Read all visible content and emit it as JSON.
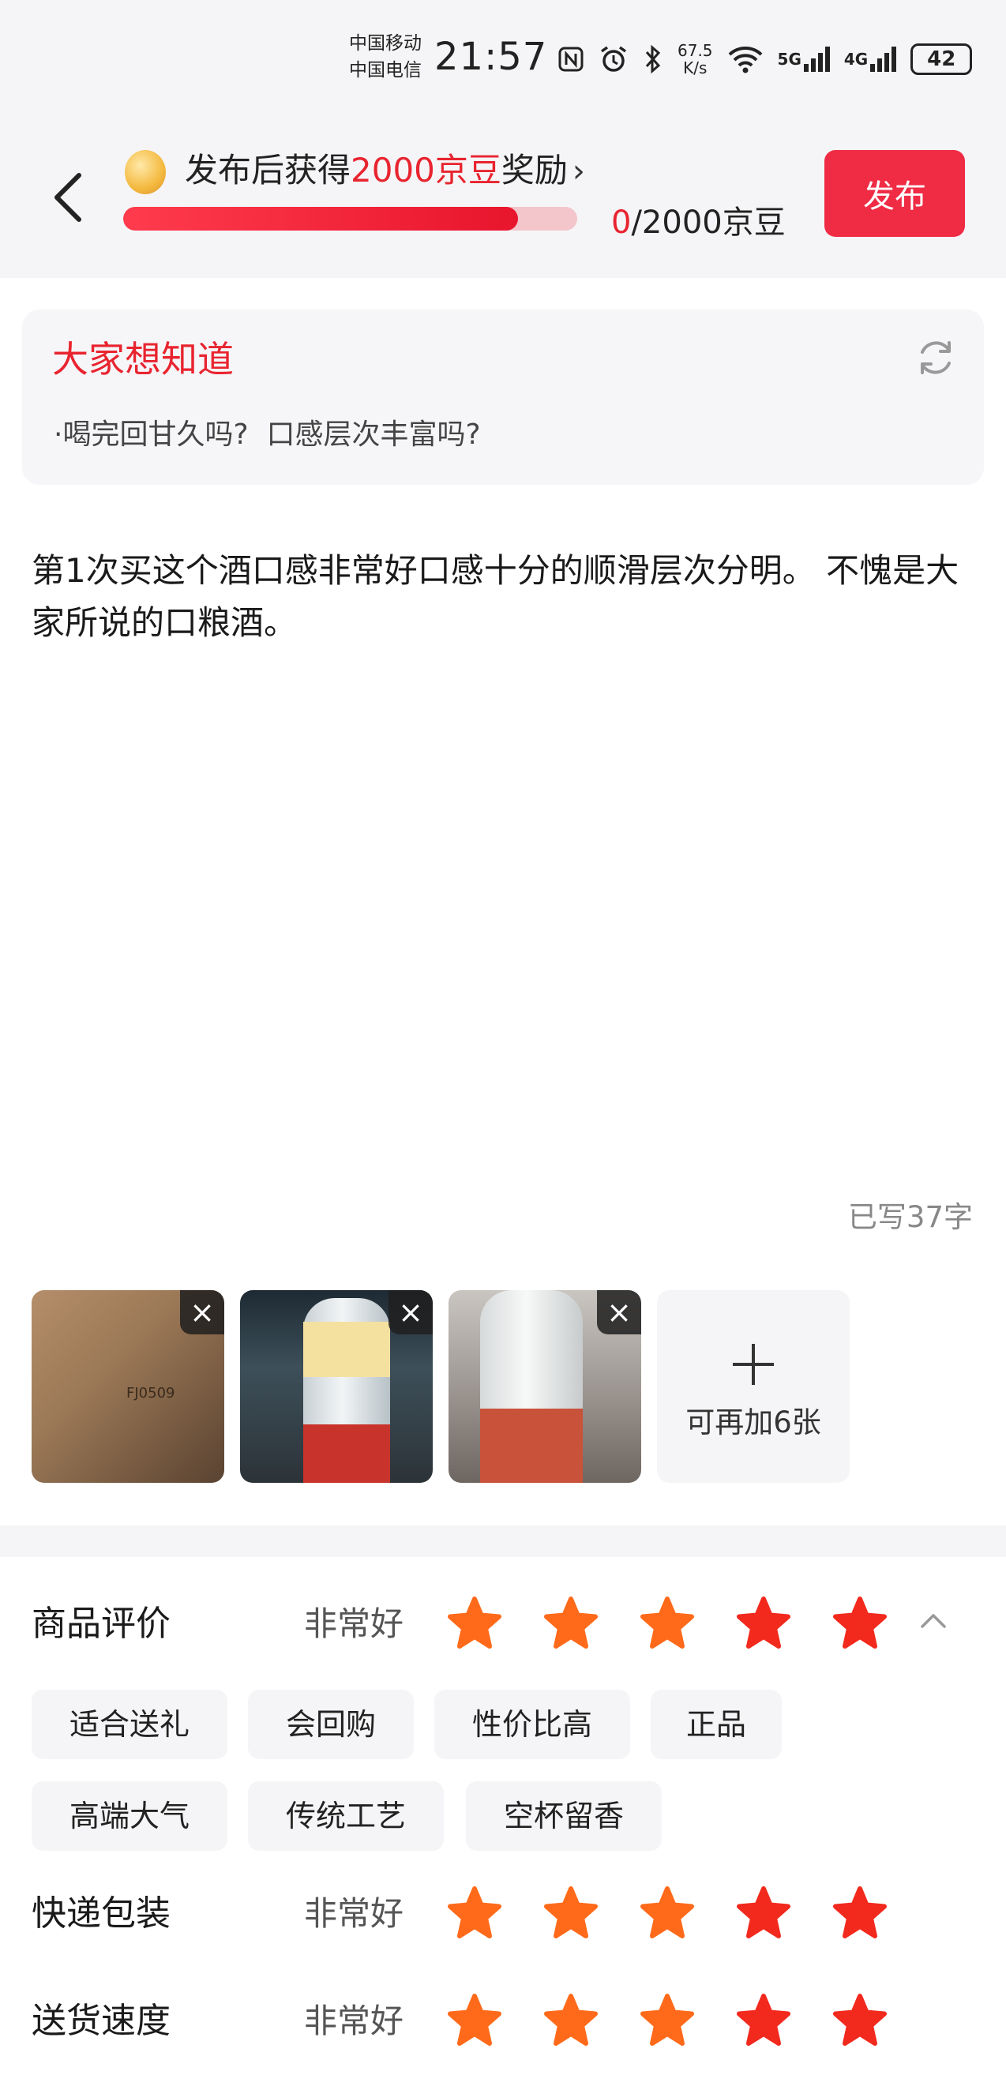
{
  "status_bar": {
    "carrier_1": "中国移动",
    "carrier_2": "中国电信",
    "time": "21:57",
    "net_speed_value": "67.5",
    "net_speed_unit": "K/s",
    "signal_1": "5G",
    "signal_2": "4G",
    "battery": "42"
  },
  "header": {
    "reward_prefix": "发布后获得",
    "reward_amount": "2000京豆",
    "reward_suffix": "奖励",
    "progress_current": "0",
    "progress_total": "/2000京豆",
    "progress_fraction": 0.87,
    "publish_label": "发布"
  },
  "questions": {
    "title": "大家想知道",
    "bullet": "·",
    "q1": "喝完回甘久吗?",
    "q2": "口感层次丰富吗?"
  },
  "review": {
    "text": "第1次买这个酒口感非常好口感十分的顺滑层次分明。 不愧是大家所说的口粮酒。",
    "word_count": "已写37字"
  },
  "photos": {
    "add_label": "可再加6张",
    "box_text": "FJ0509"
  },
  "ratings": [
    {
      "label": "商品评价",
      "value": "非常好",
      "stars": 5
    },
    {
      "label": "快递包装",
      "value": "非常好",
      "stars": 5
    },
    {
      "label": "送货速度",
      "value": "非常好",
      "stars": 5
    }
  ],
  "tags": [
    "适合送礼",
    "会回购",
    "性价比高",
    "正品",
    "高端大气",
    "传统工艺",
    "空杯留香"
  ],
  "colors": {
    "accent": "#e8242f",
    "publish": "#f02b44",
    "star_a": "#ff6a1a",
    "star_b": "#f2291d"
  }
}
